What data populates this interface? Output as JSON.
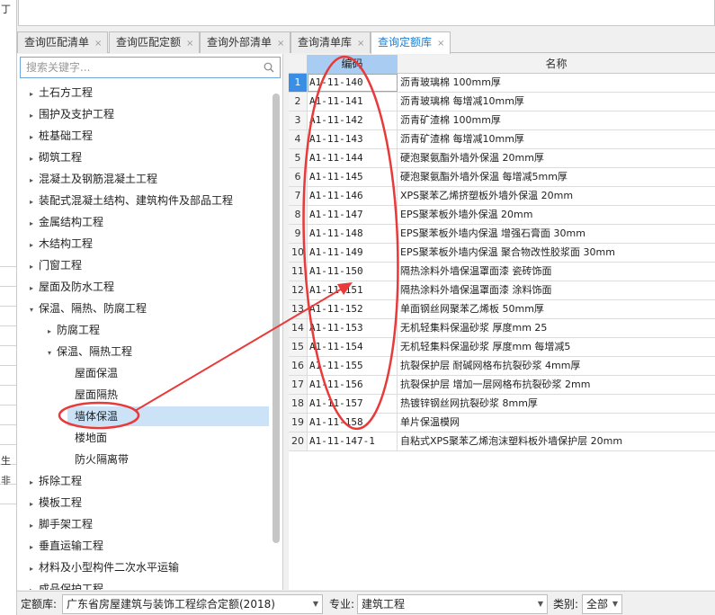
{
  "left_strip": {
    "glyph_a": "丁",
    "glyph_b": "生",
    "glyph_c": "非"
  },
  "tabs": [
    {
      "label": "查询匹配清单"
    },
    {
      "label": "查询匹配定额"
    },
    {
      "label": "查询外部清单"
    },
    {
      "label": "查询清单库"
    },
    {
      "label": "查询定额库"
    }
  ],
  "tab_close": "×",
  "search": {
    "placeholder": "搜索关键字..."
  },
  "tree": [
    {
      "label": "土石方工程",
      "arrow": "▸"
    },
    {
      "label": "围护及支护工程",
      "arrow": "▸"
    },
    {
      "label": "桩基础工程",
      "arrow": "▸"
    },
    {
      "label": "砌筑工程",
      "arrow": "▸"
    },
    {
      "label": "混凝土及钢筋混凝土工程",
      "arrow": "▸"
    },
    {
      "label": "装配式混凝土结构、建筑构件及部品工程",
      "arrow": "▸"
    },
    {
      "label": "金属结构工程",
      "arrow": "▸"
    },
    {
      "label": "木结构工程",
      "arrow": "▸"
    },
    {
      "label": "门窗工程",
      "arrow": "▸"
    },
    {
      "label": "屋面及防水工程",
      "arrow": "▸"
    },
    {
      "label": "保温、隔热、防腐工程",
      "arrow": "▾"
    },
    {
      "label": "防腐工程",
      "arrow": "▸"
    },
    {
      "label": "保温、隔热工程",
      "arrow": "▾"
    },
    {
      "label": "屋面保温",
      "arrow": ""
    },
    {
      "label": "屋面隔热",
      "arrow": ""
    },
    {
      "label": "墙体保温",
      "arrow": ""
    },
    {
      "label": "楼地面",
      "arrow": ""
    },
    {
      "label": "防火隔离带",
      "arrow": ""
    },
    {
      "label": "拆除工程",
      "arrow": "▸"
    },
    {
      "label": "模板工程",
      "arrow": "▸"
    },
    {
      "label": "脚手架工程",
      "arrow": "▸"
    },
    {
      "label": "垂直运输工程",
      "arrow": "▸"
    },
    {
      "label": "材料及小型构件二次水平运输",
      "arrow": "▸"
    },
    {
      "label": "成品保护工程",
      "arrow": "▸"
    }
  ],
  "grid": {
    "headers": {
      "code": "编码",
      "name": "名称"
    },
    "rows": [
      {
        "no": "1",
        "code": "A1-11-140",
        "name": "沥青玻璃棉 100mm厚"
      },
      {
        "no": "2",
        "code": "A1-11-141",
        "name": "沥青玻璃棉 每增减10mm厚"
      },
      {
        "no": "3",
        "code": "A1-11-142",
        "name": "沥青矿渣棉 100mm厚"
      },
      {
        "no": "4",
        "code": "A1-11-143",
        "name": "沥青矿渣棉 每增减10mm厚"
      },
      {
        "no": "5",
        "code": "A1-11-144",
        "name": "硬泡聚氨酯外墙外保温 20mm厚"
      },
      {
        "no": "6",
        "code": "A1-11-145",
        "name": "硬泡聚氨酯外墙外保温 每增减5mm厚"
      },
      {
        "no": "7",
        "code": "A1-11-146",
        "name": "XPS聚苯乙烯挤塑板外墙外保温 20mm"
      },
      {
        "no": "8",
        "code": "A1-11-147",
        "name": "EPS聚苯板外墙外保温 20mm"
      },
      {
        "no": "9",
        "code": "A1-11-148",
        "name": "EPS聚苯板外墙内保温 增强石膏面 30mm"
      },
      {
        "no": "10",
        "code": "A1-11-149",
        "name": "EPS聚苯板外墙内保温 聚合物改性胶浆面 30mm"
      },
      {
        "no": "11",
        "code": "A1-11-150",
        "name": "隔热涂料外墙保温罩面漆 瓷砖饰面"
      },
      {
        "no": "12",
        "code": "A1-11-151",
        "name": "隔热涂料外墙保温罩面漆 涂料饰面"
      },
      {
        "no": "13",
        "code": "A1-11-152",
        "name": "单面钢丝网聚苯乙烯板 50mm厚"
      },
      {
        "no": "14",
        "code": "A1-11-153",
        "name": "无机轻集料保温砂浆 厚度mm 25"
      },
      {
        "no": "15",
        "code": "A1-11-154",
        "name": "无机轻集料保温砂浆 厚度mm 每增减5"
      },
      {
        "no": "16",
        "code": "A1-11-155",
        "name": "抗裂保护层 耐碱网格布抗裂砂浆 4mm厚"
      },
      {
        "no": "17",
        "code": "A1-11-156",
        "name": "抗裂保护层 增加一层网格布抗裂砂浆 2mm"
      },
      {
        "no": "18",
        "code": "A1-11-157",
        "name": "热镀锌钢丝网抗裂砂浆 8mm厚"
      },
      {
        "no": "19",
        "code": "A1-11-158",
        "name": "单片保温模网"
      },
      {
        "no": "20",
        "code": "A1-11-147-1",
        "name": "自粘式XPS聚苯乙烯泡沫塑料板外墙保护层 20mm"
      }
    ]
  },
  "bottom": {
    "quota_label": "定额库:",
    "quota_value": "广东省房屋建筑与装饰工程综合定额(2018)",
    "major_label": "专业:",
    "major_value": "建筑工程",
    "category_label": "类别:",
    "category_value": "全部"
  },
  "colors": {
    "accent": "#1f7dd1",
    "annotation": "#e83a3a",
    "selection": "#cce3f7"
  }
}
